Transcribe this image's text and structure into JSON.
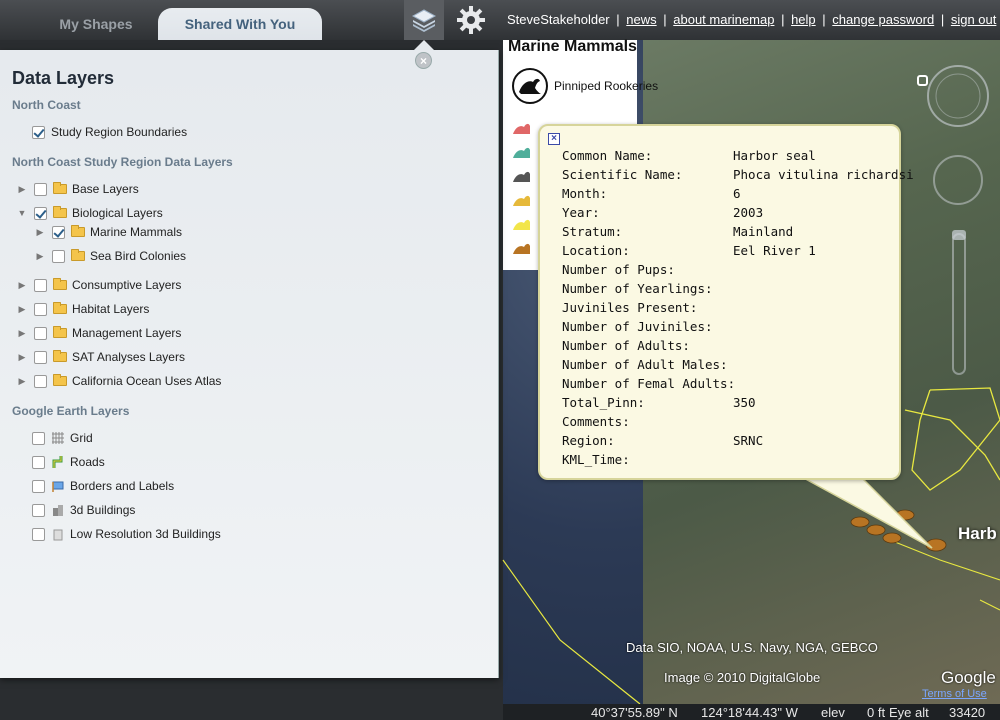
{
  "tabs": [
    {
      "label": "My Shapes"
    },
    {
      "label": "Shared With You"
    }
  ],
  "toolbar": {
    "layers_icon": "layers-icon",
    "settings_icon": "gear-icon"
  },
  "user_nav": {
    "username": "SteveStakeholder",
    "links": [
      "news",
      "about marinemap",
      "help",
      "change password",
      "sign out"
    ],
    "separator": "|"
  },
  "panel": {
    "title": "Data Layers",
    "sections": {
      "north_coast": "North Coast",
      "ncsr": "North Coast Study Region Data Layers",
      "google_earth": "Google Earth Layers"
    },
    "north_coast_items": [
      {
        "label": "Study Region Boundaries",
        "checked": true
      }
    ],
    "ncsr_items": [
      {
        "label": "Base Layers",
        "checked": false,
        "expanded": false
      },
      {
        "label": "Biological Layers",
        "checked": true,
        "expanded": true
      },
      {
        "label": "Marine Mammals",
        "checked": true,
        "expanded": false
      },
      {
        "label": "Sea Bird Colonies",
        "checked": false,
        "expanded": false
      },
      {
        "label": "Consumptive Layers",
        "checked": false,
        "expanded": false
      },
      {
        "label": "Habitat Layers",
        "checked": false,
        "expanded": false
      },
      {
        "label": "Management Layers",
        "checked": false,
        "expanded": false
      },
      {
        "label": "SAT Analyses Layers",
        "checked": false,
        "expanded": false
      },
      {
        "label": "California Ocean Uses Atlas",
        "checked": false,
        "expanded": false
      }
    ],
    "google_earth_items": [
      {
        "label": "Grid",
        "icon": "grid-icon"
      },
      {
        "label": "Roads",
        "icon": "roads-icon"
      },
      {
        "label": "Borders and Labels",
        "icon": "flag-icon"
      },
      {
        "label": "3d Buildings",
        "icon": "buildings-icon"
      },
      {
        "label": "Low Resolution 3d Buildings",
        "icon": "building-low-icon"
      }
    ]
  },
  "legend": {
    "title": "Marine Mammals",
    "item": "Pinniped Rookeries"
  },
  "balloon": {
    "rows": [
      {
        "key": "Common Name:",
        "value": "Harbor seal"
      },
      {
        "key": "Scientific Name:",
        "value": "Phoca vitulina richardsi"
      },
      {
        "key": "Month:",
        "value": "6"
      },
      {
        "key": "Year:",
        "value": "2003"
      },
      {
        "key": "Stratum:",
        "value": "Mainland"
      },
      {
        "key": "Location:",
        "value": "Eel River 1"
      },
      {
        "key": "Number of Pups:",
        "value": ""
      },
      {
        "key": "Number of Yearlings:",
        "value": ""
      },
      {
        "key": "Juviniles Present:",
        "value": ""
      },
      {
        "key": "Number of Juviniles:",
        "value": ""
      },
      {
        "key": "Number of Adults:",
        "value": ""
      },
      {
        "key": "Number of Adult Males:",
        "value": ""
      },
      {
        "key": "Number of Femal Adults:",
        "value": ""
      },
      {
        "key": "Total_Pinn:",
        "value": "350"
      },
      {
        "key": "Comments:",
        "value": ""
      },
      {
        "key": "Region:",
        "value": "SRNC"
      },
      {
        "key": "KML_Time:",
        "value": ""
      }
    ]
  },
  "map": {
    "attribution": "Data SIO, NOAA, U.S. Navy, NGA, GEBCO",
    "image_credit": "Image © 2010 DigitalGlobe",
    "google_logo": "Google",
    "terms": "Terms of Use",
    "place_label": "Harb",
    "status": {
      "lat": "40°37'55.89\" N",
      "lon": "124°18'44.43\" W",
      "elev_label": "elev",
      "elev_value": "0 ft",
      "eye_label": "Eye alt",
      "eye_value": "33420"
    }
  },
  "colors": {
    "accent": "#44627d",
    "balloon_bg": "#fbf9e3",
    "coast_line": "#e8e840"
  }
}
